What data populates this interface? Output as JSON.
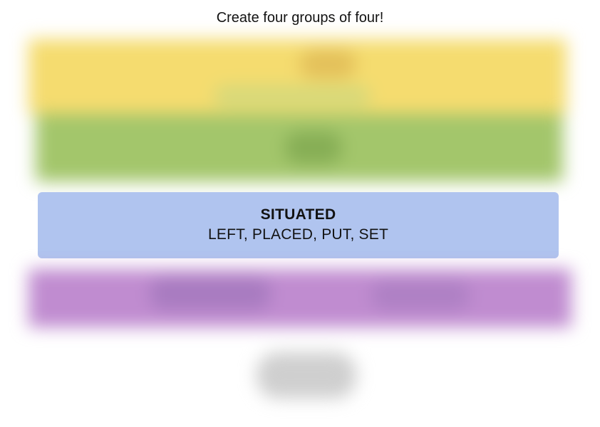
{
  "header": {
    "prompt": "Create four groups of four!"
  },
  "solved_groups": [
    {
      "category": "SITUATED",
      "members": "LEFT, PLACED, PUT, SET",
      "color": "#b0c4ef"
    }
  ],
  "obscured_groups": [
    {
      "color_name": "yellow",
      "color": "#f5dc6f"
    },
    {
      "color_name": "green",
      "color": "#a3c66b"
    },
    {
      "color_name": "purple",
      "color": "#c08cd0"
    },
    {
      "color_name": "grey",
      "color": "#cfcfcf"
    }
  ]
}
